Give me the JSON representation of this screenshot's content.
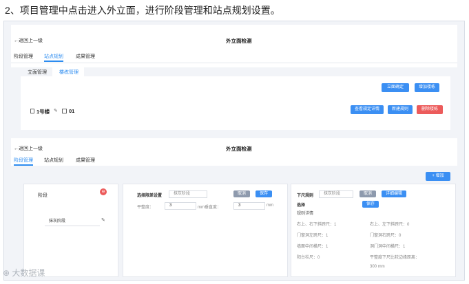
{
  "heading": "2、项目管理中点击进入外立面，进行阶段管理和站点规划设置。",
  "top": {
    "back": "←返回上一级",
    "title": "外立面检测",
    "tabs": [
      "阶段管理",
      "站点规划",
      "成果管理"
    ],
    "subtabs": [
      "立面管理",
      "楼栋管理"
    ],
    "buttons": {
      "facade_confirm": "立面确定",
      "add_building": "增加楼栋",
      "view_spec": "查看规定详情",
      "build_rule": "新建规则",
      "delete_building": "删除楼栋"
    },
    "building": {
      "name": "1号楼",
      "count": "01"
    }
  },
  "bottom": {
    "back": "←返回上一级",
    "title": "外立面检测",
    "tabs": [
      "阶段管理",
      "站点规划",
      "成果管理"
    ],
    "add_button": "+ 增加",
    "stage": {
      "label": "阶段",
      "input_value": "抹灰阶段"
    },
    "middle": {
      "select_label": "选择限差设置",
      "select_value": "抹灰阶段",
      "cancel": "取消",
      "save": "保存",
      "row_label": "平整度：",
      "value1": "3",
      "unit_mid": "mm垂直度：",
      "value2": "3",
      "unit_end": "mm"
    },
    "right": {
      "rule_label": "下尺规则",
      "rule_value": "抹灰阶段",
      "cancel": "取消",
      "edit": "详细编辑",
      "select_label": "选择",
      "save": "保存",
      "detail_title": "规则详情",
      "details": [
        "右上、右下斜跨尺：1",
        "右上、左下斜跨尺：0",
        "门窗洞左跨尺：1",
        "门窗洞右跨尺：0",
        "墙面中间横尺：1",
        "洞门洞中间横尺：1",
        "阳台栏尺：0",
        "平整度下尺比较边缘距离：",
        "300 mm"
      ]
    }
  },
  "watermark": "大数据课"
}
